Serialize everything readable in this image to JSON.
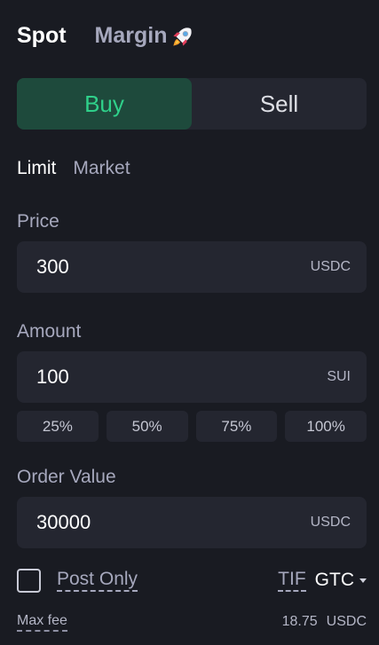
{
  "mode_tabs": {
    "spot": "Spot",
    "margin": "Margin"
  },
  "side": {
    "buy": "Buy",
    "sell": "Sell"
  },
  "order_types": {
    "limit": "Limit",
    "market": "Market"
  },
  "price": {
    "label": "Price",
    "value": "300",
    "unit": "USDC"
  },
  "amount": {
    "label": "Amount",
    "value": "100",
    "unit": "SUI"
  },
  "percent_buttons": [
    "25%",
    "50%",
    "75%",
    "100%"
  ],
  "order_value": {
    "label": "Order Value",
    "value": "30000",
    "unit": "USDC"
  },
  "post_only": {
    "label": "Post Only",
    "checked": false
  },
  "tif": {
    "label": "TIF",
    "value": "GTC"
  },
  "max_fee": {
    "label": "Max fee",
    "value": "18.75",
    "unit": "USDC"
  },
  "colors": {
    "buy_accent": "#2fd08a",
    "buy_bg": "#1e4a3c",
    "panel_bg": "#191b22",
    "field_bg": "#242630"
  },
  "icons": {
    "margin_badge": "rocket-icon",
    "tif_dropdown": "caret-down-icon"
  }
}
